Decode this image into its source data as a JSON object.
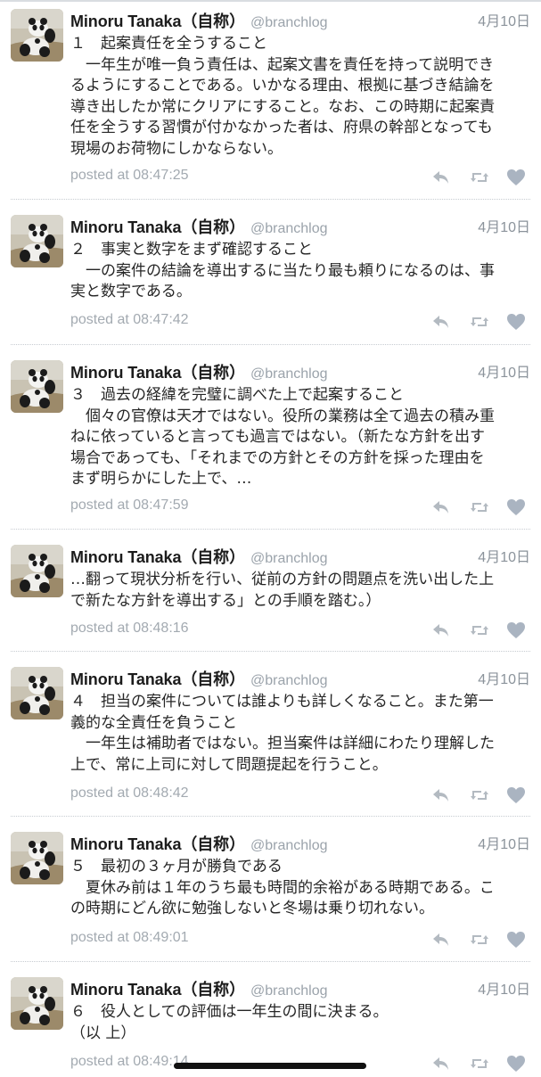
{
  "tweets": [
    {
      "display_name": "Minoru Tanaka（自称）",
      "screen_name": "@branchlog",
      "date": "4月10日",
      "lines": [
        "１　起案責任を全うすること",
        "　一年生が唯一負う責任は、起案文書を責任を持って説明でき",
        "るようにすることである。いかなる理由、根拠に基づき結論を",
        "導き出したか常にクリアにすること。なお、この時期に起案責",
        "任を全うする習慣が付かなかった者は、府県の幹部となっても",
        "現場のお荷物にしかならない。"
      ],
      "posted": "posted at 08:47:25"
    },
    {
      "display_name": "Minoru Tanaka（自称）",
      "screen_name": "@branchlog",
      "date": "4月10日",
      "lines": [
        "２　事実と数字をまず確認すること",
        "　一の案件の結論を導出するに当たり最も頼りになるのは、事",
        "実と数字である。"
      ],
      "posted": "posted at 08:47:42"
    },
    {
      "display_name": "Minoru Tanaka（自称）",
      "screen_name": "@branchlog",
      "date": "4月10日",
      "lines": [
        "３　過去の経緯を完璧に調べた上で起案すること",
        "　個々の官僚は天才ではない。役所の業務は全て過去の積み重",
        "ねに依っていると言っても過言ではない。（新たな方針を出す",
        "場合であっても、「それまでの方針とその方針を採った理由を",
        "まず明らかにした上で、…"
      ],
      "posted": "posted at 08:47:59"
    },
    {
      "display_name": "Minoru Tanaka（自称）",
      "screen_name": "@branchlog",
      "date": "4月10日",
      "lines": [
        "…翻って現状分析を行い、従前の方針の問題点を洗い出した上",
        "で新たな方針を導出する」との手順を踏む。）"
      ],
      "posted": "posted at 08:48:16"
    },
    {
      "display_name": "Minoru Tanaka（自称）",
      "screen_name": "@branchlog",
      "date": "4月10日",
      "lines": [
        "４　担当の案件については誰よりも詳しくなること。また第一",
        "義的な全責任を負うこと",
        "　一年生は補助者ではない。担当案件は詳細にわたり理解した",
        "上で、常に上司に対して問題提起を行うこと。"
      ],
      "posted": "posted at 08:48:42"
    },
    {
      "display_name": "Minoru Tanaka（自称）",
      "screen_name": "@branchlog",
      "date": "4月10日",
      "lines": [
        "５　最初の３ヶ月が勝負である",
        "　夏休み前は１年のうち最も時間的余裕がある時期である。こ",
        "の時期にどん欲に勉強しないと冬場は乗り切れない。"
      ],
      "posted": "posted at 08:49:01"
    },
    {
      "display_name": "Minoru Tanaka（自称）",
      "screen_name": "@branchlog",
      "date": "4月10日",
      "lines": [
        "６　役人としての評価は一年生の間に決まる。",
        "（以 上）"
      ],
      "posted": "posted at 08:49:14"
    }
  ],
  "icons": {
    "reply": "reply-icon",
    "retweet": "retweet-icon",
    "favorite": "heart-icon",
    "avatar": "panda-avatar"
  },
  "colors": {
    "icon_gray": "#b3bac1",
    "heart": "#aab4c1",
    "meta_text": "#a3aab1"
  }
}
